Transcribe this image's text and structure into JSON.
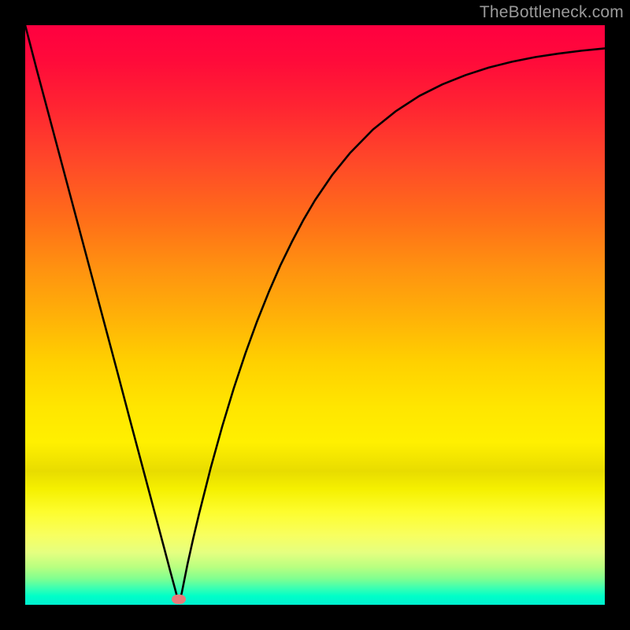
{
  "watermark": "TheBottleneck.com",
  "chart_data": {
    "type": "line",
    "title": "",
    "xlabel": "",
    "ylabel": "",
    "xlim": [
      0,
      100
    ],
    "ylim": [
      0,
      100
    ],
    "grid": false,
    "legend": false,
    "marker": {
      "x": 26.5,
      "y": 1.0,
      "color": "#e77a7a"
    },
    "series": [
      {
        "name": "curve",
        "stroke": "#000000",
        "x": [
          0,
          2,
          4,
          6,
          8,
          10,
          12,
          14,
          16,
          18,
          20,
          22,
          24,
          25,
          26,
          26.5,
          27,
          28,
          29,
          30,
          32,
          34,
          36,
          38,
          40,
          42,
          44,
          46,
          48,
          50,
          53,
          56,
          60,
          64,
          68,
          72,
          76,
          80,
          84,
          88,
          92,
          96,
          100
        ],
        "y": [
          100,
          92.3,
          84.8,
          77.3,
          69.8,
          62.3,
          54.8,
          47.3,
          39.8,
          32.2,
          24.7,
          17.2,
          9.7,
          5.9,
          2.2,
          0.3,
          2.0,
          7.0,
          11.5,
          15.7,
          23.6,
          30.8,
          37.4,
          43.4,
          48.9,
          53.9,
          58.5,
          62.6,
          66.4,
          69.8,
          74.2,
          77.9,
          82.0,
          85.2,
          87.8,
          89.8,
          91.4,
          92.7,
          93.7,
          94.5,
          95.1,
          95.6,
          96.0
        ]
      }
    ],
    "background_gradient": {
      "direction": "vertical",
      "stops": [
        {
          "pos": 0.0,
          "color": "#ff0040"
        },
        {
          "pos": 0.24,
          "color": "#ff4a28"
        },
        {
          "pos": 0.5,
          "color": "#ffb008"
        },
        {
          "pos": 0.72,
          "color": "#fff000"
        },
        {
          "pos": 0.88,
          "color": "#f8ff60"
        },
        {
          "pos": 0.95,
          "color": "#80ff90"
        },
        {
          "pos": 1.0,
          "color": "#00f0d0"
        }
      ]
    }
  }
}
